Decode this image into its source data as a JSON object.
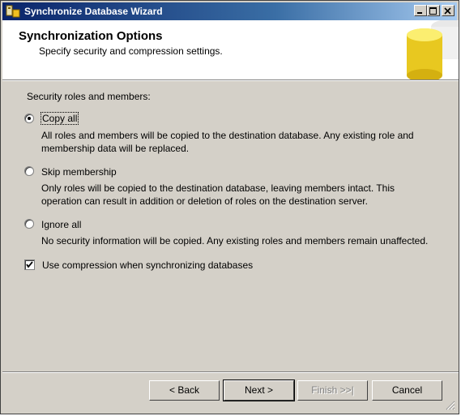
{
  "window": {
    "title": "Synchronize Database Wizard"
  },
  "header": {
    "title": "Synchronization Options",
    "subtitle": "Specify security and compression settings."
  },
  "section_label": "Security roles and members:",
  "options": [
    {
      "label": "Copy all",
      "selected": true,
      "description": [
        "All roles and members will be copied to the destination database. Any existing role and",
        "membership data will be replaced."
      ]
    },
    {
      "label": "Skip membership",
      "selected": false,
      "description": [
        "Only roles will be copied to the destination database, leaving members intact. This",
        "operation can result in addition or deletion of roles on the destination server."
      ]
    },
    {
      "label": "Ignore all",
      "selected": false,
      "description": [
        "No security information will be copied.  Any existing roles and members remain unaffected."
      ]
    }
  ],
  "compression": {
    "label": "Use compression when synchronizing databases",
    "checked": true
  },
  "buttons": {
    "back": "< Back",
    "next": "Next >",
    "finish": "Finish >>|",
    "cancel": "Cancel"
  }
}
